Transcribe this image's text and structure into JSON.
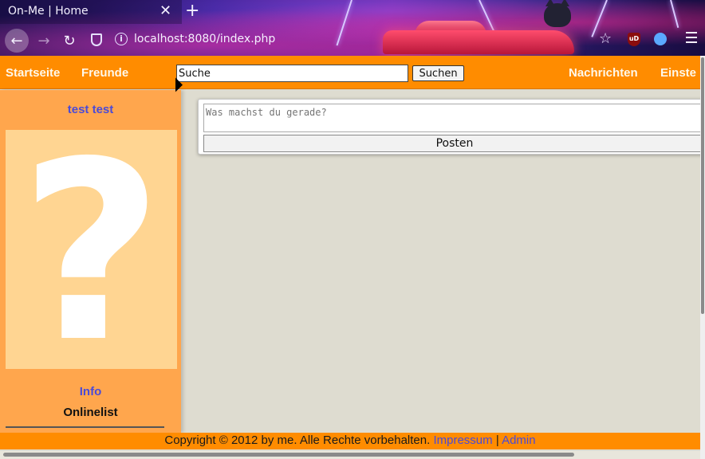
{
  "browser": {
    "tab_title": "On-Me | Home",
    "tab_close": "✕",
    "new_tab": "+",
    "url": "localhost:8080/index.php",
    "back": "←",
    "forward": "→",
    "reload": "↻",
    "star": "☆",
    "ublock_label": "uD",
    "info": "i"
  },
  "topbar": {
    "links": [
      "Startseite",
      "Freunde",
      "Nachrichten",
      "Einste"
    ],
    "search_value": "Suche",
    "search_button": "Suchen"
  },
  "sidebar": {
    "user_name": "test test",
    "avatar_glyph": "?",
    "info_link": "Info",
    "online_label": "Onlinelist"
  },
  "post": {
    "placeholder": "Was machst du gerade?",
    "button": "Posten"
  },
  "footer": {
    "copyright": "Copyright © 2012 by me. Alle Rechte vorbehalten.",
    "impressum": "Impressum",
    "separator": "|",
    "admin": "Admin"
  },
  "colors": {
    "topbar": "#ff8c00",
    "sidebar": "#ffa64d",
    "avatar_bg": "#ffd592",
    "link": "#4a4ad8",
    "page_bg": "#dedcd0"
  }
}
